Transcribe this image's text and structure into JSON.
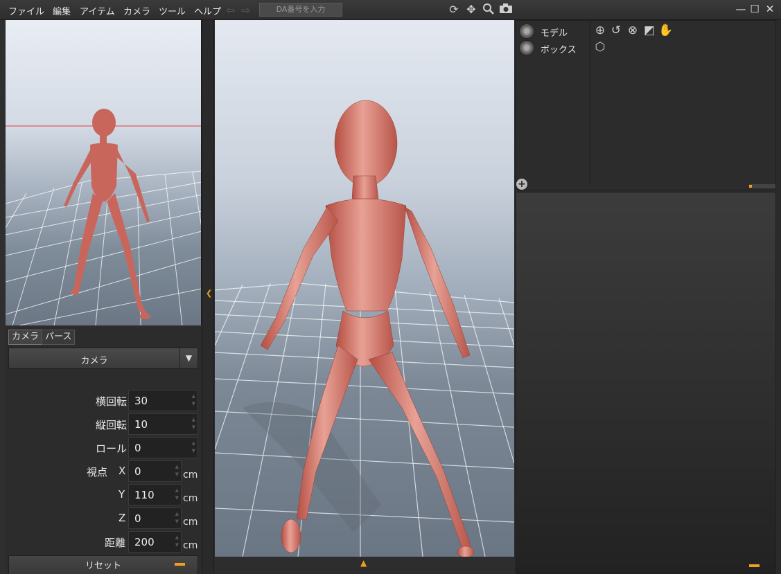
{
  "menu": [
    "ファイル",
    "編集",
    "アイテム",
    "カメラ",
    "ツール",
    "ヘルプ"
  ],
  "toolbar": {
    "da_placeholder": "DA番号を入力",
    "icons": [
      "rotate-icon",
      "move-icon",
      "zoom-icon",
      "camera-icon"
    ]
  },
  "window_controls": {
    "minimize": "—",
    "maximize": "☐",
    "close": "✕"
  },
  "camera_panel": {
    "tabs": [
      "カメラ",
      "パース"
    ],
    "active_tab": "カメラ",
    "dropdown_value": "カメラ",
    "fields": {
      "yaw": {
        "label": "横回転",
        "value": "30"
      },
      "pitch": {
        "label": "縦回転",
        "value": "10"
      },
      "roll": {
        "label": "ロール",
        "value": "0"
      },
      "view_label": "視点",
      "view_x": {
        "axis": "X",
        "value": "0",
        "unit": "cm"
      },
      "view_y": {
        "axis": "Y",
        "value": "110",
        "unit": "cm"
      },
      "view_z": {
        "axis": "Z",
        "value": "0",
        "unit": "cm"
      },
      "distance": {
        "label": "距離",
        "value": "200",
        "unit": "cm"
      }
    },
    "reset_label": "リセット"
  },
  "objects": [
    {
      "label": "モデル"
    },
    {
      "label": "ボックス"
    }
  ],
  "tool_icons": [
    "move-gizmo-icon",
    "rotate-gizmo-icon",
    "scale-gizmo-icon",
    "select-gizmo-icon",
    "hand-gizmo-icon"
  ],
  "colors": {
    "accent": "#f0a020",
    "figure": "#d4756a",
    "grid": "#ffffff"
  }
}
